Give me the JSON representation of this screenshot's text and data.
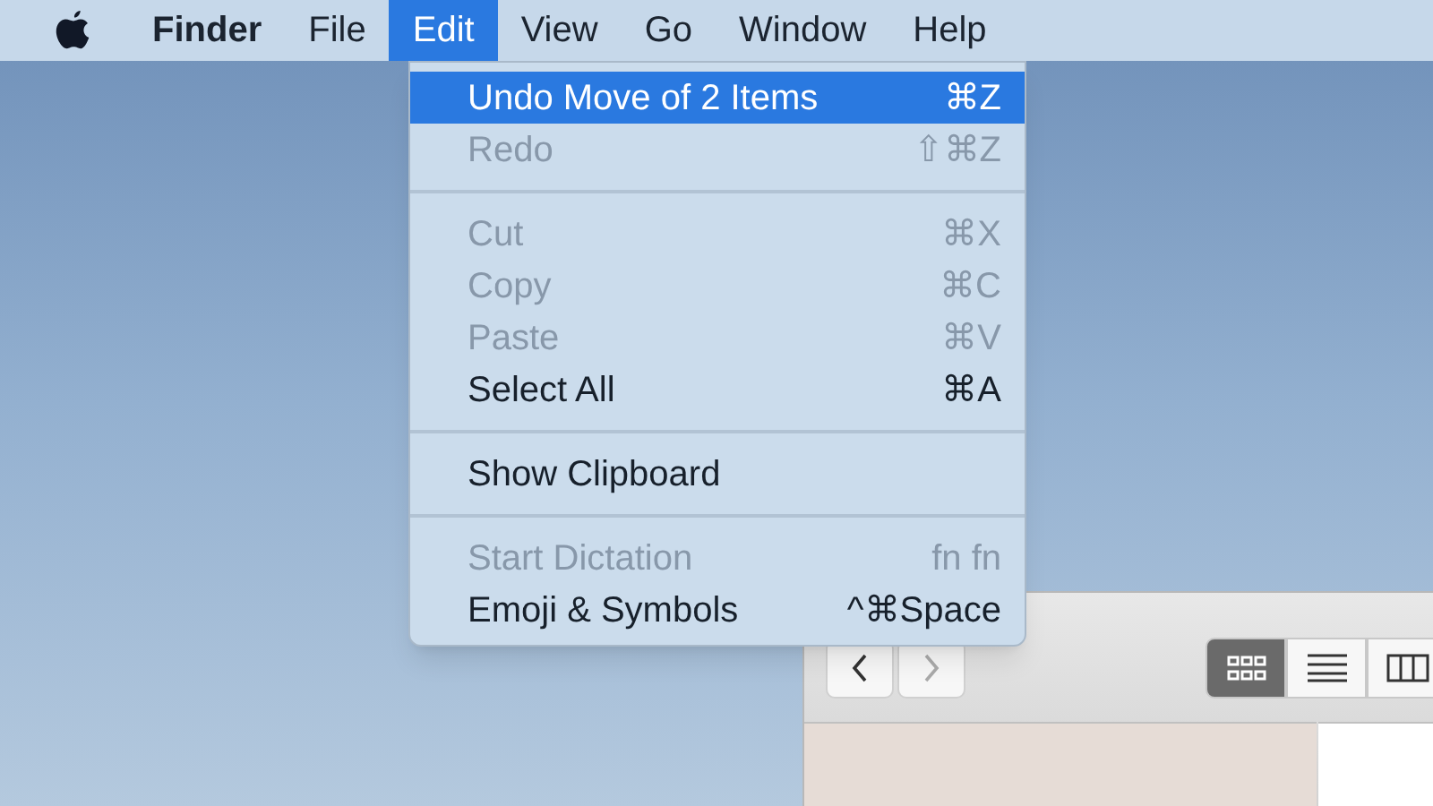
{
  "menu_bar": [
    {
      "label": "Finder",
      "bold": true,
      "selected": false
    },
    {
      "label": "File",
      "bold": false,
      "selected": false
    },
    {
      "label": "Edit",
      "bold": false,
      "selected": true
    },
    {
      "label": "View",
      "bold": false,
      "selected": false
    },
    {
      "label": "Go",
      "bold": false,
      "selected": false
    },
    {
      "label": "Window",
      "bold": false,
      "selected": false
    },
    {
      "label": "Help",
      "bold": false,
      "selected": false
    }
  ],
  "menu": [
    {
      "kind": "item",
      "label": "Undo Move of 2 Items",
      "shortcut": "⌘Z",
      "disabled": false,
      "selected": true
    },
    {
      "kind": "item",
      "label": "Redo",
      "shortcut": "⇧⌘Z",
      "disabled": true,
      "selected": false
    },
    {
      "kind": "separator"
    },
    {
      "kind": "item",
      "label": "Cut",
      "shortcut": "⌘X",
      "disabled": true,
      "selected": false
    },
    {
      "kind": "item",
      "label": "Copy",
      "shortcut": "⌘C",
      "disabled": true,
      "selected": false
    },
    {
      "kind": "item",
      "label": "Paste",
      "shortcut": "⌘V",
      "disabled": true,
      "selected": false
    },
    {
      "kind": "item",
      "label": "Select All",
      "shortcut": "⌘A",
      "disabled": false,
      "selected": false
    },
    {
      "kind": "separator"
    },
    {
      "kind": "item",
      "label": "Show Clipboard",
      "disabled": false,
      "selected": false
    },
    {
      "kind": "separator"
    },
    {
      "kind": "item",
      "label": "Start Dictation",
      "shortcut": "fn fn",
      "disabled": true,
      "selected": false
    },
    {
      "kind": "item",
      "label": "Emoji & Symbols",
      "shortcut": "^⌘Space",
      "disabled": false,
      "selected": false
    }
  ],
  "finder_window": {
    "view_modes": [
      {
        "kind": "icons",
        "selected": true
      },
      {
        "kind": "list",
        "selected": false
      },
      {
        "kind": "columns",
        "selected": false
      }
    ]
  }
}
